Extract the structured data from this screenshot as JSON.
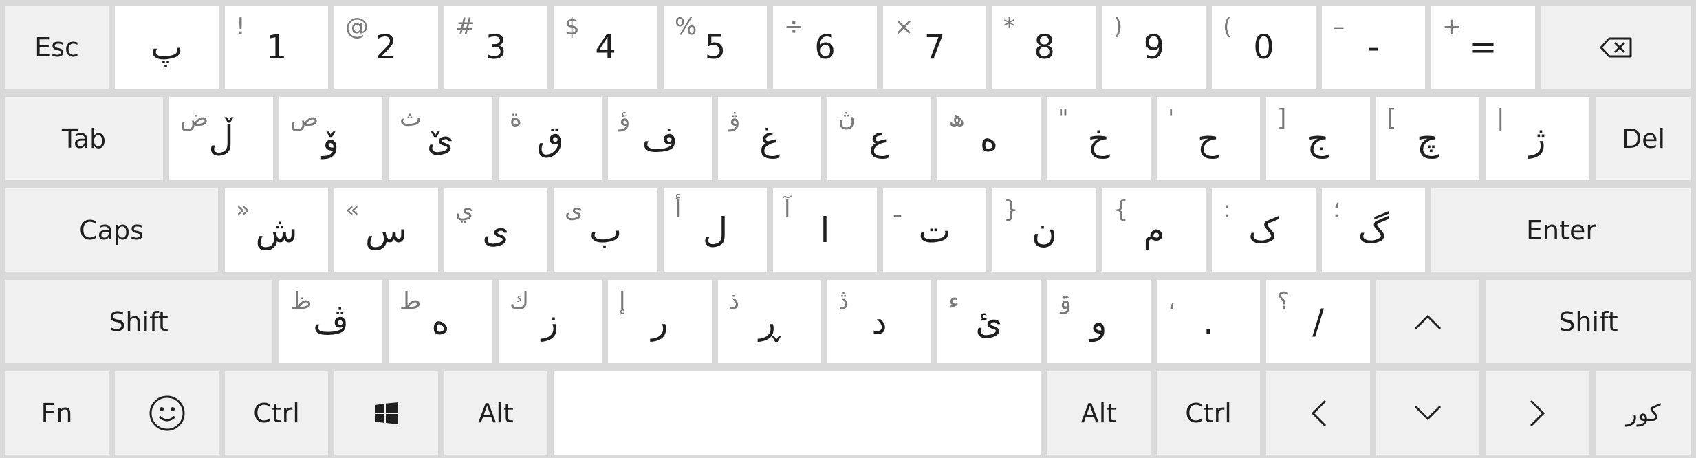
{
  "row1": [
    {
      "main": "Esc"
    },
    {
      "main": "پ"
    },
    {
      "shift": "!",
      "main": "1"
    },
    {
      "shift": "@",
      "main": "2"
    },
    {
      "shift": "#",
      "main": "3"
    },
    {
      "shift": "$",
      "main": "4"
    },
    {
      "shift": "%",
      "main": "5"
    },
    {
      "shift": "÷",
      "main": "6"
    },
    {
      "shift": "×",
      "main": "7"
    },
    {
      "shift": "*",
      "main": "8"
    },
    {
      "shift": ")",
      "main": "9"
    },
    {
      "shift": "(",
      "main": "0"
    },
    {
      "shift": "–",
      "main": "-"
    },
    {
      "shift": "+",
      "main": "="
    },
    {
      "icon": "backspace-icon"
    }
  ],
  "row2": [
    {
      "main": "Tab"
    },
    {
      "shift": "ض",
      "main": "ڵ"
    },
    {
      "shift": "ص",
      "main": "ۆ"
    },
    {
      "shift": "ث",
      "main": "ێ"
    },
    {
      "shift": "ة",
      "main": "ق"
    },
    {
      "shift": "ؤ",
      "main": "ف"
    },
    {
      "shift": "ۋ",
      "main": "غ"
    },
    {
      "shift": "ڽ",
      "main": "ع"
    },
    {
      "shift": "ھ",
      "main": "ه"
    },
    {
      "shift": "\"",
      "main": "خ"
    },
    {
      "shift": "'",
      "main": "ح"
    },
    {
      "shift": "]",
      "main": "ج"
    },
    {
      "shift": "[",
      "main": "چ"
    },
    {
      "shift": "|",
      "main": "ژ"
    },
    {
      "main": "Del"
    }
  ],
  "row3": [
    {
      "main": "Caps"
    },
    {
      "shift": "»",
      "main": "ش"
    },
    {
      "shift": "«",
      "main": "س"
    },
    {
      "shift": "ي",
      "main": "ی"
    },
    {
      "shift": "ى",
      "main": "ب"
    },
    {
      "shift": "أ",
      "main": "ل"
    },
    {
      "shift": "آ",
      "main": "ا"
    },
    {
      "shift": "ـ",
      "main": "ت"
    },
    {
      "shift": "}",
      "main": "ن"
    },
    {
      "shift": "{",
      "main": "م"
    },
    {
      "shift": ":",
      "main": "ک"
    },
    {
      "shift": "؛",
      "main": "گ"
    },
    {
      "main": "Enter"
    }
  ],
  "row4": [
    {
      "main": "Shift"
    },
    {
      "shift": "ظ",
      "main": "ڤ"
    },
    {
      "shift": "ط",
      "main": "ه"
    },
    {
      "shift": "ك",
      "main": "ز"
    },
    {
      "shift": "إ",
      "main": "ر"
    },
    {
      "shift": "ذ",
      "main": "ڕ"
    },
    {
      "shift": "ڎ",
      "main": "د"
    },
    {
      "shift": "ء",
      "main": "ئ"
    },
    {
      "shift": "ۊ",
      "main": "و"
    },
    {
      "shift": "،",
      "main": "."
    },
    {
      "shift": "؟",
      "main": "/"
    },
    {
      "icon": "arrow-up-icon"
    },
    {
      "main": "Shift"
    }
  ],
  "row5": [
    {
      "main": "Fn"
    },
    {
      "icon": "emoji-icon"
    },
    {
      "main": "Ctrl"
    },
    {
      "icon": "windows-icon"
    },
    {
      "main": "Alt"
    },
    {
      "icon": "space"
    },
    {
      "main": "Alt"
    },
    {
      "main": "Ctrl"
    },
    {
      "icon": "arrow-left-icon"
    },
    {
      "icon": "arrow-down-icon"
    },
    {
      "icon": "arrow-right-icon"
    },
    {
      "main": "کور"
    }
  ]
}
